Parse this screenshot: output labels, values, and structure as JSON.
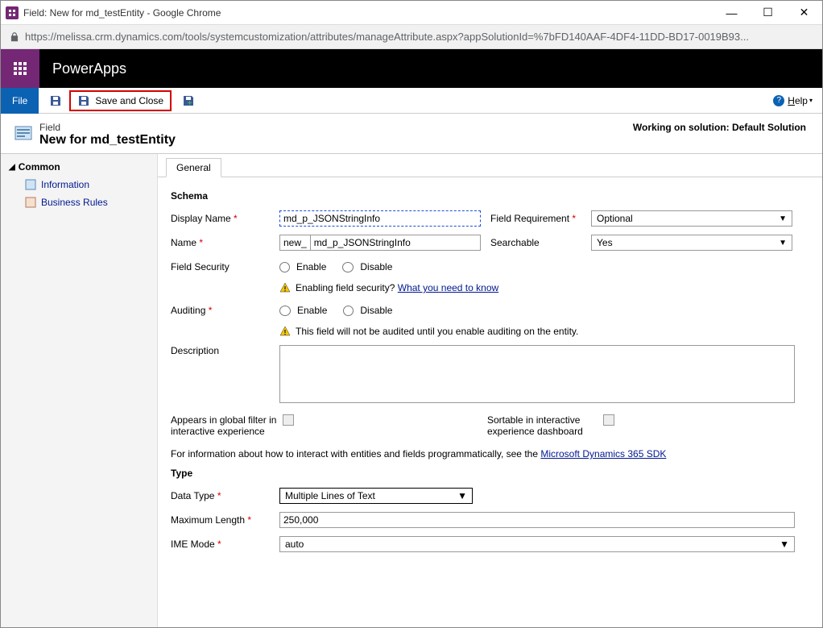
{
  "window": {
    "title": "Field: New for md_testEntity - Google Chrome",
    "url": "https://melissa.crm.dynamics.com/tools/systemcustomization/attributes/manageAttribute.aspx?appSolutionId=%7bFD140AAF-4DF4-11DD-BD17-0019B93..."
  },
  "header": {
    "brand": "PowerApps"
  },
  "ribbon": {
    "file": "File",
    "save_close": "Save and Close",
    "help": "Help"
  },
  "crumb": {
    "small": "Field",
    "big": "New for md_testEntity",
    "solution": "Working on solution: Default Solution"
  },
  "nav": {
    "section": "Common",
    "items": [
      "Information",
      "Business Rules"
    ]
  },
  "tabs": {
    "general": "General"
  },
  "sections": {
    "schema": "Schema",
    "type": "Type"
  },
  "labels": {
    "display_name": "Display Name",
    "field_requirement": "Field Requirement",
    "name": "Name",
    "searchable": "Searchable",
    "field_security": "Field Security",
    "enable": "Enable",
    "disable": "Disable",
    "auditing": "Auditing",
    "description": "Description",
    "appears_filter": "Appears in global filter in interactive experience",
    "sortable": "Sortable in interactive experience dashboard",
    "data_type": "Data Type",
    "max_length": "Maximum Length",
    "ime_mode": "IME Mode"
  },
  "values": {
    "display_name": "md_p_JSONStringInfo",
    "name_prefix": "new_",
    "name": "md_p_JSONStringInfo",
    "requirement": "Optional",
    "searchable": "Yes",
    "data_type": "Multiple Lines of Text",
    "max_length": "250,000",
    "ime_mode": "auto"
  },
  "hints": {
    "security_warn": "Enabling field security?",
    "security_link": "What you need to know",
    "audit_warn": "This field will not be audited until you enable auditing on the entity.",
    "sdk_pre": "For information about how to interact with entities and fields programmatically, see the ",
    "sdk_link": "Microsoft Dynamics 365 SDK"
  }
}
